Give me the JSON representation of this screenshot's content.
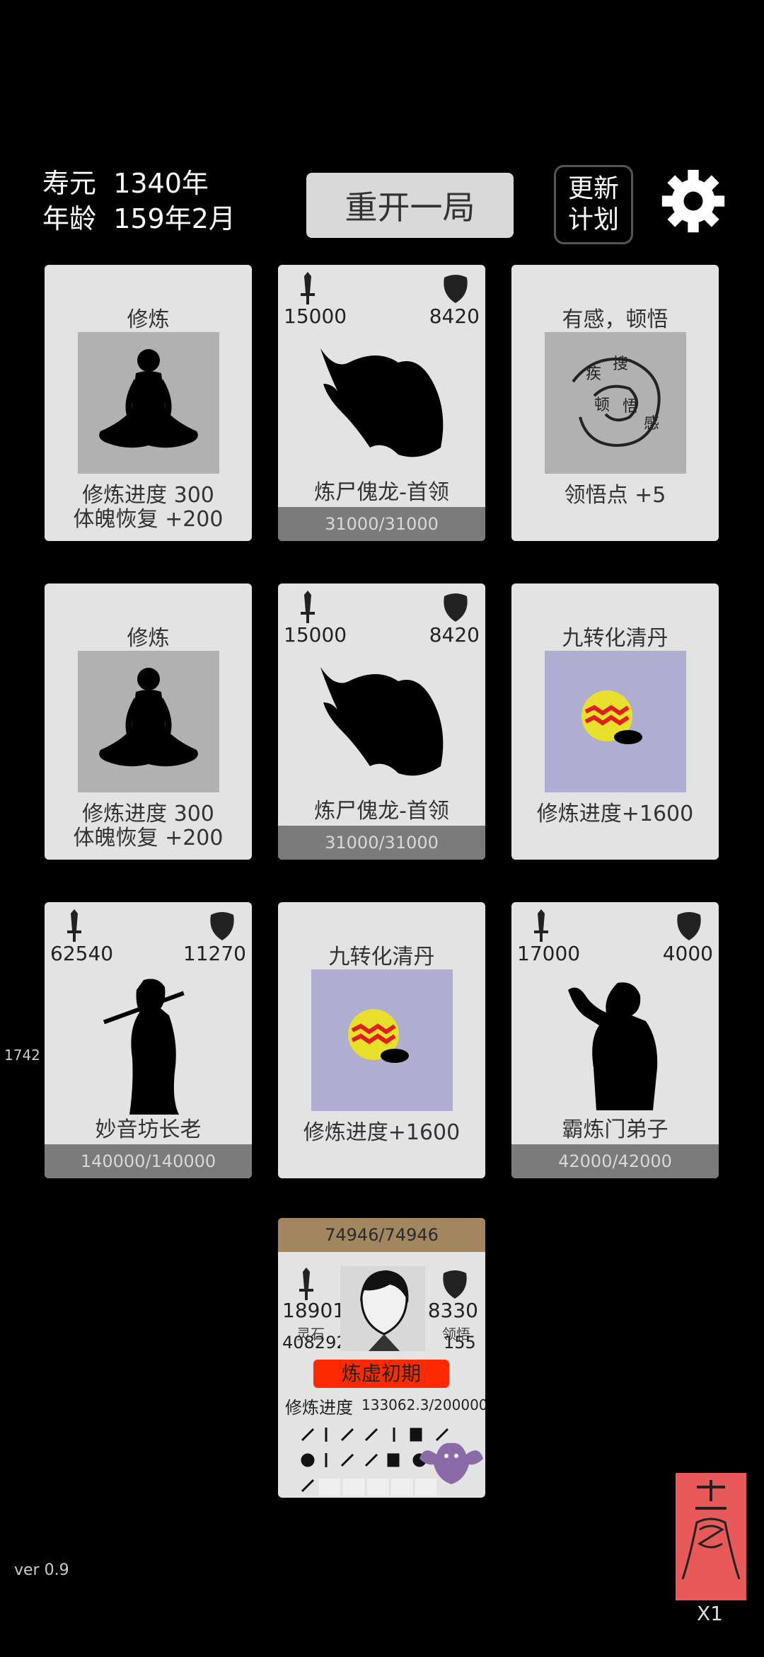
{
  "hud": {
    "lifespan_label": "寿元",
    "lifespan_value": "1340年",
    "age_label": "年龄",
    "age_value": "159年2月",
    "restart_label": "重开一局",
    "plan_label_1": "更新",
    "plan_label_2": "计划",
    "settings_icon": "gear-icon"
  },
  "cards": [
    {
      "kind": "cultivate",
      "title": "修炼",
      "line1": "修炼进度  300",
      "line2": "体魄恢复  +200",
      "icon": "meditating-figure-icon"
    },
    {
      "kind": "enemy",
      "atk": "15000",
      "def": "8420",
      "name": "炼尸傀龙-首领",
      "hp": "31000/31000",
      "icon": "dragon-silhouette-icon"
    },
    {
      "kind": "insight",
      "title": "有感，顿悟",
      "line1": "领悟点  +5",
      "icon": "swirling-characters-icon"
    },
    {
      "kind": "cultivate",
      "title": "修炼",
      "line1": "修炼进度  300",
      "line2": "体魄恢复  +200",
      "icon": "meditating-figure-icon"
    },
    {
      "kind": "enemy",
      "atk": "15000",
      "def": "8420",
      "name": "炼尸傀龙-首领",
      "hp": "31000/31000",
      "icon": "dragon-silhouette-icon"
    },
    {
      "kind": "pill",
      "title": "九转化清丹",
      "line1": "修炼进度+1600",
      "icon": "pill-icon"
    },
    {
      "kind": "enemy",
      "atk": "62540",
      "def": "11270",
      "name": "妙音坊长老",
      "hp": "140000/140000",
      "icon": "flute-player-icon"
    },
    {
      "kind": "pill",
      "title": "九转化清丹",
      "line1": "修炼进度+1600",
      "icon": "pill-icon"
    },
    {
      "kind": "enemy",
      "atk": "17000",
      "def": "4000",
      "name": "霸炼门弟子",
      "hp": "42000/42000",
      "icon": "muscle-man-icon"
    }
  ],
  "player": {
    "hp": "74946/74946",
    "atk": "18901",
    "def": "8330",
    "spirit_stone_label": "灵石",
    "spirit_stone_value": "408292",
    "insight_label": "领悟",
    "insight_value": "155",
    "realm": "炼虚初期",
    "progress_label": "修炼进度",
    "progress_value": "133062.3/200000",
    "portrait_icon": "player-portrait-icon"
  },
  "misc": {
    "version": "ver 0.9",
    "side_number": "1742",
    "talisman_count": "X1",
    "talisman_icon": "talisman-icon"
  },
  "colors": {
    "background": "#000000",
    "card": "#e3e3e3",
    "hp_bar": "#7b7b7b",
    "player_hp": "#a2865f",
    "realm": "#ff2a00",
    "talisman": "#e85a5a"
  }
}
